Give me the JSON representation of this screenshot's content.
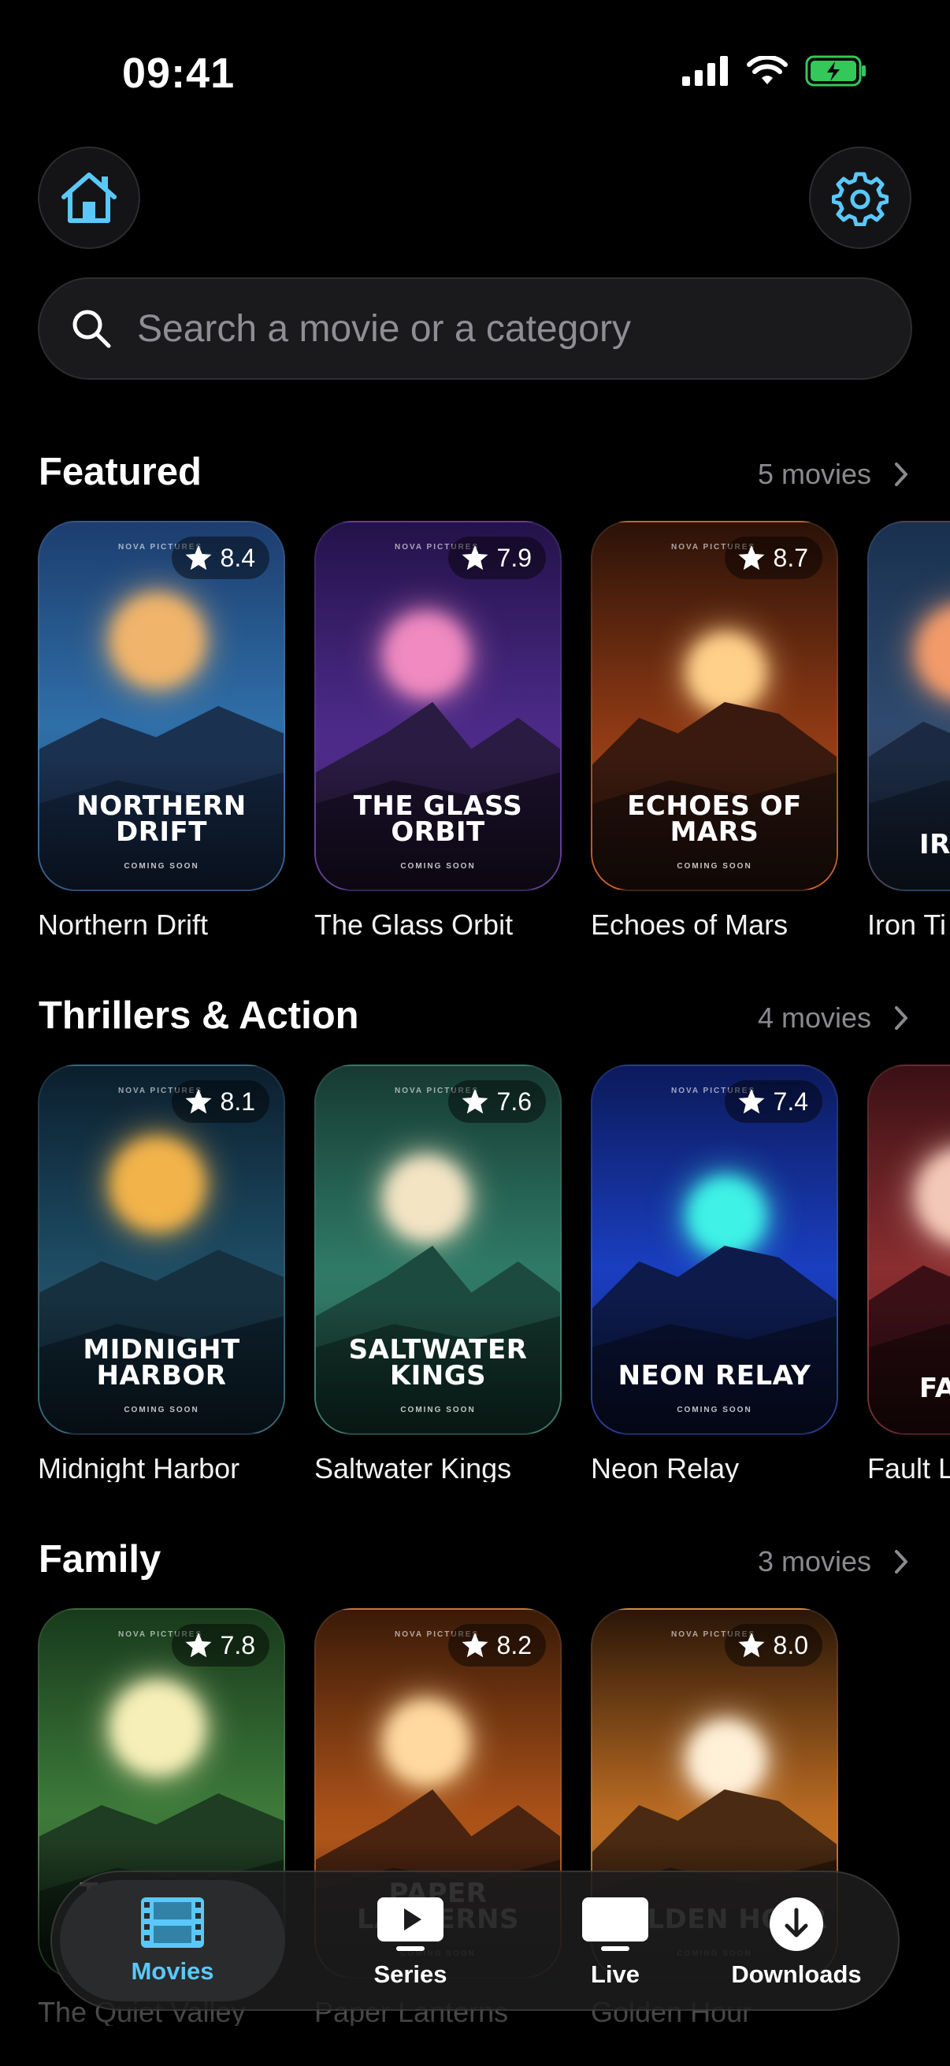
{
  "status_bar": {
    "time": "09:41"
  },
  "search": {
    "placeholder": "Search a movie or a category"
  },
  "sections": [
    {
      "title": "Featured",
      "count": "5 movies",
      "movies": [
        {
          "label": "Northern Drift",
          "poster_title": "NORTHERN\nDRIFT",
          "rating": "8.4",
          "studio": "NOVA PICTURES",
          "tag": "COMING SOON"
        },
        {
          "label": "The Glass Orbit",
          "poster_title": "THE GLASS\nORBIT",
          "rating": "7.9",
          "studio": "NOVA PICTURES",
          "tag": "COMING SOON"
        },
        {
          "label": "Echoes of Mars",
          "poster_title": "ECHOES OF\nMARS",
          "rating": "8.7",
          "studio": "NOVA PICTURES",
          "tag": "COMING SOON"
        },
        {
          "label": "Iron Ti",
          "poster_title": "IR",
          "rating": "",
          "studio": "",
          "tag": ""
        }
      ]
    },
    {
      "title": "Thrillers & Action",
      "count": "4 movies",
      "movies": [
        {
          "label": "Midnight Harbor",
          "poster_title": "MIDNIGHT\nHARBOR",
          "rating": "8.1",
          "studio": "NOVA PICTURES",
          "tag": "COMING SOON"
        },
        {
          "label": "Saltwater Kings",
          "poster_title": "SALTWATER\nKINGS",
          "rating": "7.6",
          "studio": "NOVA PICTURES",
          "tag": "COMING SOON"
        },
        {
          "label": "Neon Relay",
          "poster_title": "NEON RELAY",
          "rating": "7.4",
          "studio": "NOVA PICTURES",
          "tag": "COMING SOON"
        },
        {
          "label": "Fault L",
          "poster_title": "FAU",
          "rating": "",
          "studio": "",
          "tag": ""
        }
      ]
    },
    {
      "title": "Family",
      "count": "3 movies",
      "movies": [
        {
          "label": "The Quiet Valley",
          "poster_title": "THE QUIET\nVALLEY",
          "rating": "7.8",
          "studio": "NOVA PICTURES",
          "tag": "COMING SOON"
        },
        {
          "label": "Paper Lanterns",
          "poster_title": "PAPER\nLANTERNS",
          "rating": "8.2",
          "studio": "NOVA PICTURES",
          "tag": "COMING SOON"
        },
        {
          "label": "Golden Hour",
          "poster_title": "GOLDEN HOUR",
          "rating": "8.0",
          "studio": "NOVA PICTURES",
          "tag": "COMING SOON"
        }
      ]
    }
  ],
  "tabbar": {
    "tabs": [
      {
        "label": "Movies",
        "icon": "film-icon",
        "active": true
      },
      {
        "label": "Series",
        "icon": "play-icon",
        "active": false
      },
      {
        "label": "Live",
        "icon": "tv-icon",
        "active": false
      },
      {
        "label": "Downloads",
        "icon": "download-icon",
        "active": false
      }
    ]
  },
  "colors": {
    "accent": "#5ac8fa",
    "background": "#000000",
    "battery": "#34c759"
  },
  "posters": [
    {
      "bg": [
        "#1d3d6e",
        "#2f6fa8",
        "#274f78"
      ],
      "sun": "#f0b46a",
      "mtn": [
        "#1b3150",
        "#13233c"
      ]
    },
    {
      "bg": [
        "#24124a",
        "#4b2a87",
        "#5b2d8e"
      ],
      "sun": "#f08ac0",
      "mtn": [
        "#2a1b42",
        "#1a1029"
      ]
    },
    {
      "bg": [
        "#2b1208",
        "#8a3814",
        "#c4561c"
      ],
      "sun": "#ffd08a",
      "mtn": [
        "#3a1a0f",
        "#24110b"
      ]
    },
    {
      "bg": [
        "#19304f",
        "#2f4a6e",
        "#3f3347"
      ],
      "sun": "#f29a6a",
      "mtn": [
        "#1b2a42",
        "#121d2e"
      ]
    },
    {
      "bg": [
        "#0b1f2e",
        "#1e4c64",
        "#2a5a6e"
      ],
      "sun": "#f2b34a",
      "mtn": [
        "#163040",
        "#0d1f2a"
      ]
    },
    {
      "bg": [
        "#163a32",
        "#2f7a66",
        "#2d6b5a"
      ],
      "sun": "#f3e4c4",
      "mtn": [
        "#1d4a3e",
        "#123229"
      ]
    },
    {
      "bg": [
        "#0c1a5a",
        "#1a3ec0",
        "#1a2a88"
      ],
      "sun": "#3ef2e6",
      "mtn": [
        "#0d1a4a",
        "#08102e"
      ]
    },
    {
      "bg": [
        "#3a1015",
        "#8a2e30",
        "#5a1c22"
      ],
      "sun": "#f4c8b8",
      "mtn": [
        "#3a1016",
        "#22090c"
      ]
    },
    {
      "bg": [
        "#183a1c",
        "#3d7a3a",
        "#2e5e2c"
      ],
      "sun": "#f6efb8",
      "mtn": [
        "#1f3d22",
        "#132717"
      ]
    },
    {
      "bg": [
        "#3a1a08",
        "#a85018",
        "#c96b22"
      ],
      "sun": "#ffd9a0",
      "mtn": [
        "#4a2410",
        "#2e160a"
      ]
    },
    {
      "bg": [
        "#2a1608",
        "#b86a22",
        "#d4842c"
      ],
      "sun": "#fff0d8",
      "mtn": [
        "#4a2a12",
        "#2c180a"
      ]
    }
  ]
}
